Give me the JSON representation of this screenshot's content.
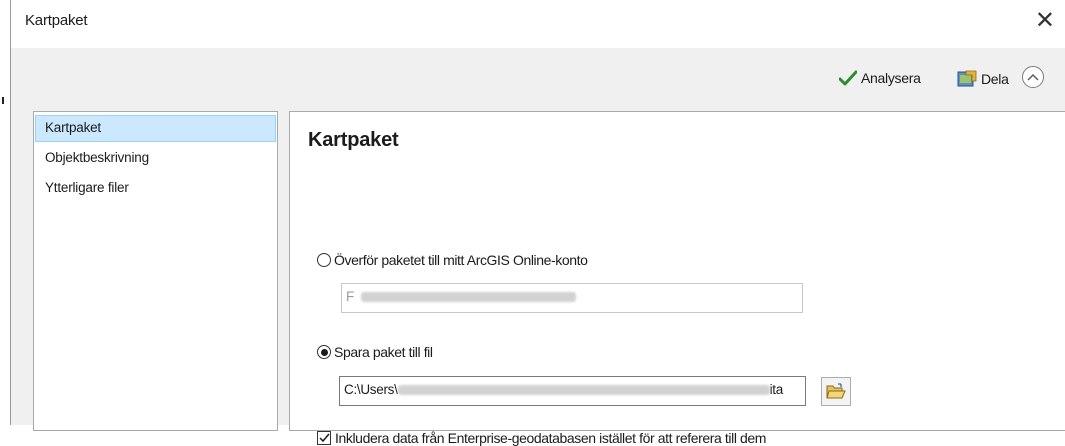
{
  "window": {
    "title": "Kartpaket",
    "close_icon": "close-icon"
  },
  "toolbar": {
    "analyze_label": "Analysera",
    "share_label": "Dela",
    "analyze_icon": "checkmark-icon",
    "share_icon": "share-icon",
    "collapse_icon": "chevron-up-circle-icon",
    "accent_check_color": "#2e8b2e"
  },
  "sidebar": {
    "items": [
      {
        "label": "Kartpaket",
        "selected": true
      },
      {
        "label": "Objektbeskrivning",
        "selected": false
      },
      {
        "label": "Ytterligare filer",
        "selected": false
      }
    ],
    "selected_bg": "#cce8ff"
  },
  "panel": {
    "heading": "Kartpaket",
    "online_option": {
      "label": "Överför paketet till mitt ArcGIS Online-konto",
      "selected": false,
      "field_value_visible": "F"
    },
    "file_option": {
      "label": "Spara paket till fil",
      "selected": true,
      "path_visible": "C:\\Users\\",
      "path_tail": "ita"
    },
    "include_enterprise": {
      "label": "Inkludera data från Enterprise-geodatabasen istället för att referera till dem",
      "checked": true
    },
    "browse_icon": "folder-open-icon"
  }
}
